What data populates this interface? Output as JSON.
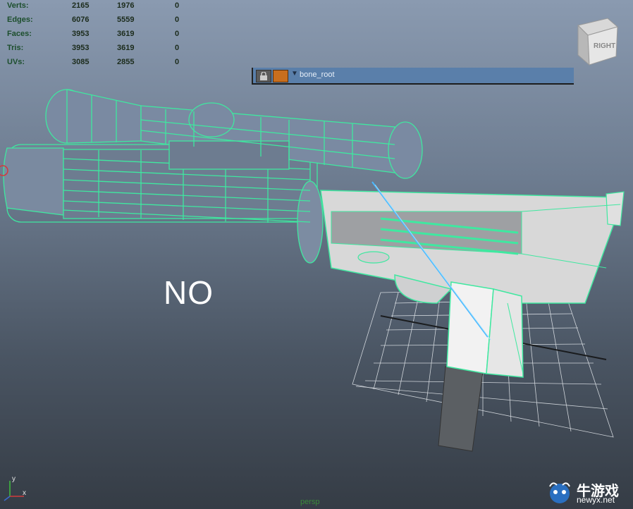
{
  "stats": {
    "rows": [
      {
        "label": "Verts:",
        "c1": "2165",
        "c2": "1976",
        "c3": "0"
      },
      {
        "label": "Edges:",
        "c1": "6076",
        "c2": "5559",
        "c3": "0"
      },
      {
        "label": "Faces:",
        "c1": "3953",
        "c2": "3619",
        "c3": "0"
      },
      {
        "label": "Tris:",
        "c1": "3953",
        "c2": "3619",
        "c3": "0"
      },
      {
        "label": "UVs:",
        "c1": "3085",
        "c2": "2855",
        "c3": "0"
      }
    ]
  },
  "outliner": {
    "item_label": "bone_root"
  },
  "viewcube": {
    "face_label": "RIGHT"
  },
  "viewport": {
    "overlay_text": "NO",
    "camera_label": "persp",
    "axis_y": "y",
    "axis_x": "x"
  },
  "watermark": {
    "title": "牛游戏",
    "url": "newyx.net"
  },
  "colors": {
    "wireframe": "#3fe8a0",
    "bone": "#4ab8ff",
    "background_top": "#8a9ab0",
    "background_bottom": "#353c45"
  }
}
